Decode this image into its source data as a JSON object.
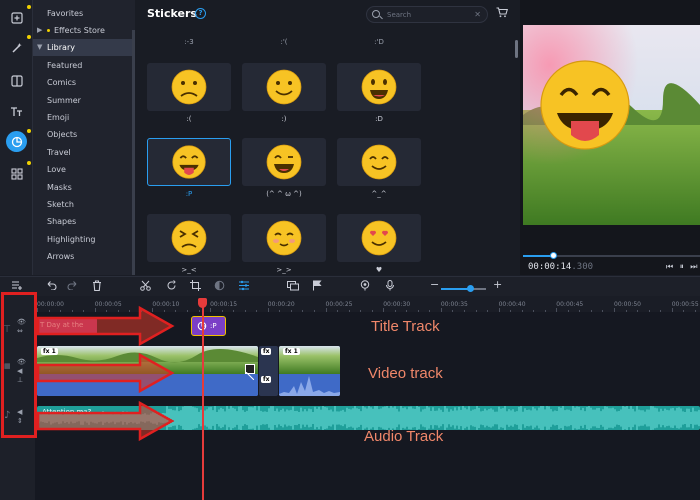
{
  "categories": {
    "items": [
      {
        "label": "Favorites"
      },
      {
        "label": "Effects Store"
      },
      {
        "label": "Library"
      },
      {
        "label": "Featured"
      },
      {
        "label": "Comics"
      },
      {
        "label": "Summer"
      },
      {
        "label": "Emoji"
      },
      {
        "label": "Objects"
      },
      {
        "label": "Travel"
      },
      {
        "label": "Love"
      },
      {
        "label": "Masks"
      },
      {
        "label": "Sketch"
      },
      {
        "label": "Shapes"
      },
      {
        "label": "Highlighting"
      },
      {
        "label": "Arrows"
      }
    ],
    "selected": "Library"
  },
  "stickers": {
    "title": "Stickers",
    "help_glyph": "?",
    "search_placeholder": "Search",
    "clear_glyph": "✕",
    "cart_glyph": "🛒",
    "top_row_labels": [
      ":-3",
      ":'(",
      ":'D"
    ],
    "tiles": [
      {
        "label": ":(",
        "face": "sad"
      },
      {
        "label": ":)",
        "face": "smile"
      },
      {
        "label": ":D",
        "face": "grin"
      },
      {
        "label": ":P",
        "face": "tongue",
        "selected": true
      },
      {
        "label": "(^ ^ ω ^)",
        "face": "happy"
      },
      {
        "label": "^_^",
        "face": "content"
      },
      {
        "label": ">_<",
        "face": "squint"
      },
      {
        "label": ">_>",
        "face": "sideeye"
      },
      {
        "label": "♥",
        "face": "hearts"
      }
    ]
  },
  "preview": {
    "timecode_main": "00:00:14",
    "timecode_frac": ".300",
    "progress_fraction": 0.17,
    "controls": "⏮ ⏸ ⏭"
  },
  "toolbar": {
    "icons": [
      "undo-icon",
      "redo-icon",
      "trash-icon",
      "scissors-icon",
      "rotate-icon",
      "crop-icon",
      "color-icon",
      "adjust-icon",
      "caption-icon",
      "flag-icon",
      "record-icon",
      "mic-icon"
    ],
    "zoom_fraction": 0.65,
    "zoom_minus": "−",
    "zoom_plus": "+"
  },
  "ruler": {
    "ticks": [
      "00:00:00",
      "00:00:05",
      "00:00:10",
      "00:00:15",
      "00:00:20",
      "00:00:25",
      "00:00:30",
      "00:00:35",
      "00:00:40",
      "00:00:45",
      "00:00:50",
      "00:00:55"
    ]
  },
  "timeline": {
    "title_clip_text": "Day at the",
    "title_clip_icon": "T",
    "sticker_clip_label": ":P",
    "audio_clip_text": "Attention ma?",
    "fx_label": "fx",
    "fx_count": "1"
  },
  "annotations": {
    "title_track": "Title Track",
    "video_track": "Video track",
    "audio_track": "Audio Track"
  },
  "colors": {
    "accent": "#2a9ef0",
    "playhead": "#e53b3b",
    "annotation": "#e02020",
    "annotation_text": "#f0876a",
    "title_clip": "#b8337b",
    "video_clip": "#3f6ac7",
    "audio_clip": "#1f9f9a"
  }
}
